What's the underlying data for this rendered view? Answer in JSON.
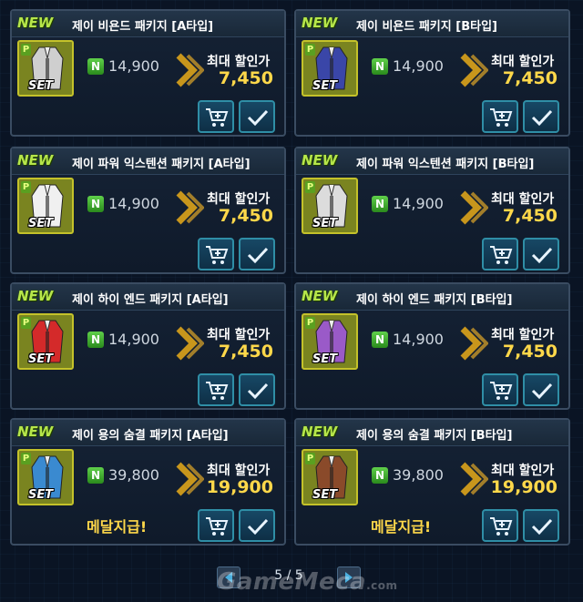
{
  "colors": {
    "accent": "#ffd84a",
    "button_border": "#2f8ea6",
    "new_badge": "#b6e64a"
  },
  "products": [
    {
      "new": "NEW",
      "title": "제이 비욘드 패키지 [A타입]",
      "price": "14,900",
      "discount_label": "최대 할인가",
      "discount_price": "7,450",
      "set": "SET",
      "badge_p": "P",
      "badge_n": "N",
      "medal": "",
      "outfit_color": "#cfcfcf"
    },
    {
      "new": "NEW",
      "title": "제이 비욘드 패키지 [B타입]",
      "price": "14,900",
      "discount_label": "최대 할인가",
      "discount_price": "7,450",
      "set": "SET",
      "badge_p": "P",
      "badge_n": "N",
      "medal": "",
      "outfit_color": "#3a46a8"
    },
    {
      "new": "NEW",
      "title": "제이 파워 익스텐션 패키지 [A타입]",
      "price": "14,900",
      "discount_label": "최대 할인가",
      "discount_price": "7,450",
      "set": "SET",
      "badge_p": "P",
      "badge_n": "N",
      "medal": "",
      "outfit_color": "#f0f0f0"
    },
    {
      "new": "NEW",
      "title": "제이 파워 익스텐션 패키지 [B타입]",
      "price": "14,900",
      "discount_label": "최대 할인가",
      "discount_price": "7,450",
      "set": "SET",
      "badge_p": "P",
      "badge_n": "N",
      "medal": "",
      "outfit_color": "#dcdcdc"
    },
    {
      "new": "NEW",
      "title": "제이 하이 엔드 패키지 [A타입]",
      "price": "14,900",
      "discount_label": "최대 할인가",
      "discount_price": "7,450",
      "set": "SET",
      "badge_p": "P",
      "badge_n": "N",
      "medal": "",
      "outfit_color": "#d42a2a"
    },
    {
      "new": "NEW",
      "title": "제이 하이 엔드 패키지 [B타입]",
      "price": "14,900",
      "discount_label": "최대 할인가",
      "discount_price": "7,450",
      "set": "SET",
      "badge_p": "P",
      "badge_n": "N",
      "medal": "",
      "outfit_color": "#9a5ac8"
    },
    {
      "new": "NEW",
      "title": "제이 용의 숨결 패키지 [A타입]",
      "price": "39,800",
      "discount_label": "최대 할인가",
      "discount_price": "19,900",
      "set": "SET",
      "badge_p": "P",
      "badge_n": "N",
      "medal": "메달지급!",
      "outfit_color": "#3a8ad0"
    },
    {
      "new": "NEW",
      "title": "제이 용의 숨결 패키지 [B타입]",
      "price": "39,800",
      "discount_label": "최대 할인가",
      "discount_price": "19,900",
      "set": "SET",
      "badge_p": "P",
      "badge_n": "N",
      "medal": "메달지급!",
      "outfit_color": "#8a4a2a"
    }
  ],
  "pagination": {
    "text": "5 / 5"
  },
  "watermark": {
    "brand": "GameMeca",
    "suffix": ".com"
  },
  "icons": {
    "cart": "cart-icon",
    "check": "check-icon",
    "prev": "prev-arrow-icon",
    "next": "next-arrow-icon"
  }
}
